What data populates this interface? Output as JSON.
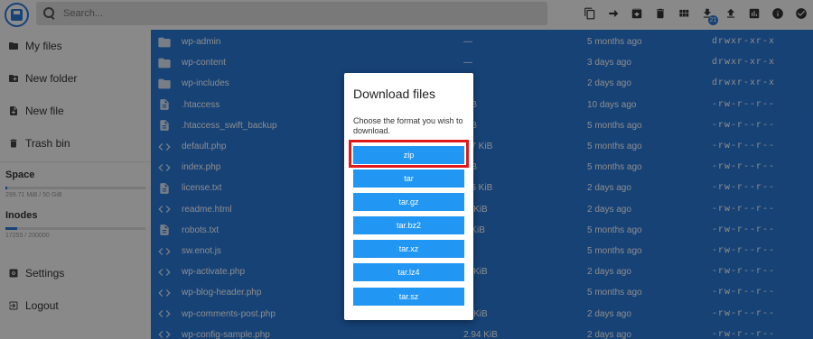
{
  "header": {
    "search_placeholder": "Search...",
    "badge_count": "21"
  },
  "sidebar": {
    "items": [
      {
        "label": "My files",
        "icon": "folder-icon"
      },
      {
        "label": "New folder",
        "icon": "new-folder-icon"
      },
      {
        "label": "New file",
        "icon": "new-file-icon"
      },
      {
        "label": "Trash bin",
        "icon": "trash-icon"
      }
    ],
    "space_label": "Space",
    "space_text": "299.71 MiB / 50 GiB",
    "space_fraction": 0.006,
    "inodes_label": "Inodes",
    "inodes_text": "17255 / 200000",
    "inodes_fraction": 0.086,
    "settings_label": "Settings",
    "logout_label": "Logout"
  },
  "files": [
    {
      "name": "wp-admin",
      "type": "folder",
      "size": "—",
      "modified": "5 months ago",
      "perm": "drwxr-xr-x"
    },
    {
      "name": "wp-content",
      "type": "folder",
      "size": "—",
      "modified": "3 days ago",
      "perm": "drwxr-xr-x"
    },
    {
      "name": "wp-includes",
      "type": "folder",
      "size": "",
      "modified": "2 days ago",
      "perm": "drwxr-xr-x"
    },
    {
      "name": ".htaccess",
      "type": "file",
      "size": "5 B",
      "modified": "10 days ago",
      "perm": "-rw-r--r--"
    },
    {
      "name": ".htaccess_swift_backup",
      "type": "file",
      "size": "5 B",
      "modified": "5 months ago",
      "perm": "-rw-r--r--"
    },
    {
      "name": "default.php",
      "type": "code",
      "size": ".97 KiB",
      "modified": "5 months ago",
      "perm": "-rw-r--r--"
    },
    {
      "name": "index.php",
      "type": "code",
      "size": "5 B",
      "modified": "5 months ago",
      "perm": "-rw-r--r--"
    },
    {
      "name": "license.txt",
      "type": "file",
      "size": ".45 KiB",
      "modified": "2 days ago",
      "perm": "-rw-r--r--"
    },
    {
      "name": "readme.html",
      "type": "code",
      "size": ".3 KiB",
      "modified": "2 days ago",
      "perm": "-rw-r--r--"
    },
    {
      "name": "robots.txt",
      "type": "file",
      "size": "3 KiB",
      "modified": "5 months ago",
      "perm": "-rw-r--r--"
    },
    {
      "name": "sw.enot.js",
      "type": "code",
      "size": "B",
      "modified": "5 months ago",
      "perm": "-rw-r--r--"
    },
    {
      "name": "wp-activate.php",
      "type": "code",
      "size": ".1 KiB",
      "modified": "2 days ago",
      "perm": "-rw-r--r--"
    },
    {
      "name": "wp-blog-header.php",
      "type": "code",
      "size": "B",
      "modified": "5 months ago",
      "perm": "-rw-r--r--"
    },
    {
      "name": "wp-comments-post.php",
      "type": "code",
      "size": ".7 KiB",
      "modified": "2 days ago",
      "perm": "-rw-r--r--"
    },
    {
      "name": "wp-config-sample.php",
      "type": "code",
      "size": "2.94 KiB",
      "modified": "2 days ago",
      "perm": "-rw-r--r--"
    }
  ],
  "dialog": {
    "title": "Download files",
    "description": "Choose the format you wish to download.",
    "formats": [
      "zip",
      "tar",
      "tar.gz",
      "tar.bz2",
      "tar.xz",
      "tar.lz4",
      "tar.sz"
    ]
  },
  "colors": {
    "accent": "#2979d8",
    "button": "#2196f3",
    "highlight": "#e01919"
  }
}
